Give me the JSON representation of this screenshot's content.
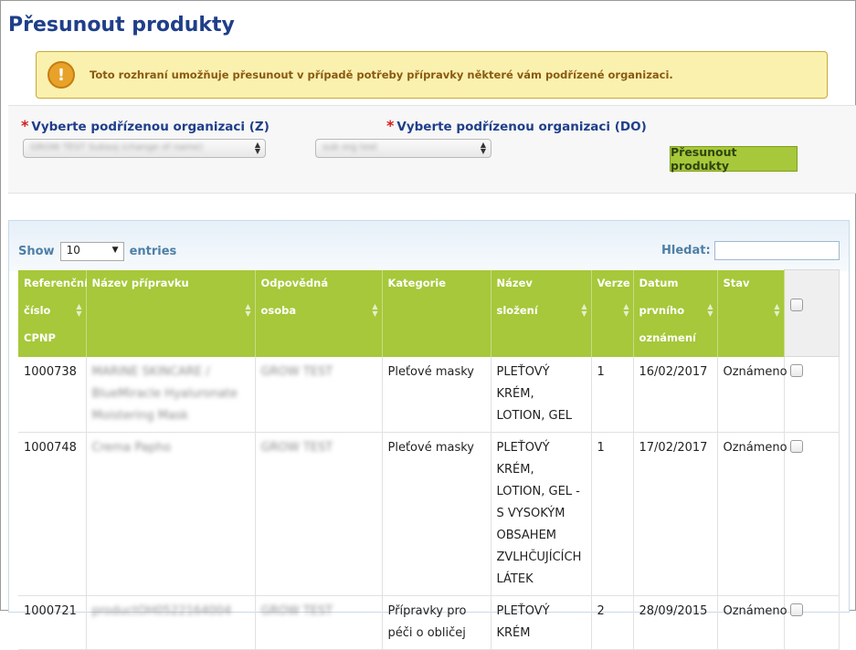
{
  "page": {
    "title": "Přesunout produkty"
  },
  "alert": {
    "text": "Toto rozhraní umožňuje přesunout v případě potřeby přípravky některé vám podřízené organizaci.",
    "icon": "warning-icon"
  },
  "form": {
    "from_label": "Vyberte podřízenou organizaci (Z)",
    "to_label": "Vyberte podřízenou organizaci (DO)",
    "required_mark": "*",
    "from_value": "GROW TEST Subsoj (change of name)",
    "to_value": "sub org test",
    "submit_label": "Přesunout produkty"
  },
  "table_controls": {
    "show_label": "Show",
    "entries_label": "entries",
    "page_length": "10",
    "search_label": "Hledat:"
  },
  "table": {
    "columns": [
      "Referenční číslo CPNP",
      "Název přípravku",
      "Odpovědná osoba",
      "Kategorie",
      "Název složení",
      "Verze",
      "Datum prvního oznámení",
      "Stav"
    ],
    "rows": [
      {
        "ref": "1000738",
        "name": "MARINE SKINCARE / BlueMiracle Hyaluronate Moistering Mask",
        "person": "GROW TEST",
        "category": "Pleťové masky",
        "composition": "PLEŤOVÝ KRÉM, LOTION, GEL",
        "version": "1",
        "date": "16/02/2017",
        "status": "Oznámeno"
      },
      {
        "ref": "1000748",
        "name": "Crema Papho",
        "person": "GROW TEST",
        "category": "Pleťové masky",
        "composition": "PLEŤOVÝ KRÉM, LOTION, GEL - S VYSOKÝM OBSAHEM ZVLHČUJÍCÍCH LÁTEK",
        "version": "1",
        "date": "17/02/2017",
        "status": "Oznámeno"
      },
      {
        "ref": "1000721",
        "name": "productOH0522164004",
        "person": "GROW TEST",
        "category": "Přípravky pro péči o obličej",
        "composition": "PLEŤOVÝ KRÉM",
        "version": "2",
        "date": "28/09/2015",
        "status": "Oznámeno"
      }
    ]
  },
  "colors": {
    "title": "#1f3f8a",
    "header_green": "#a6c83a",
    "alert_bg": "#fbf1ae",
    "required": "#d61c1c"
  }
}
